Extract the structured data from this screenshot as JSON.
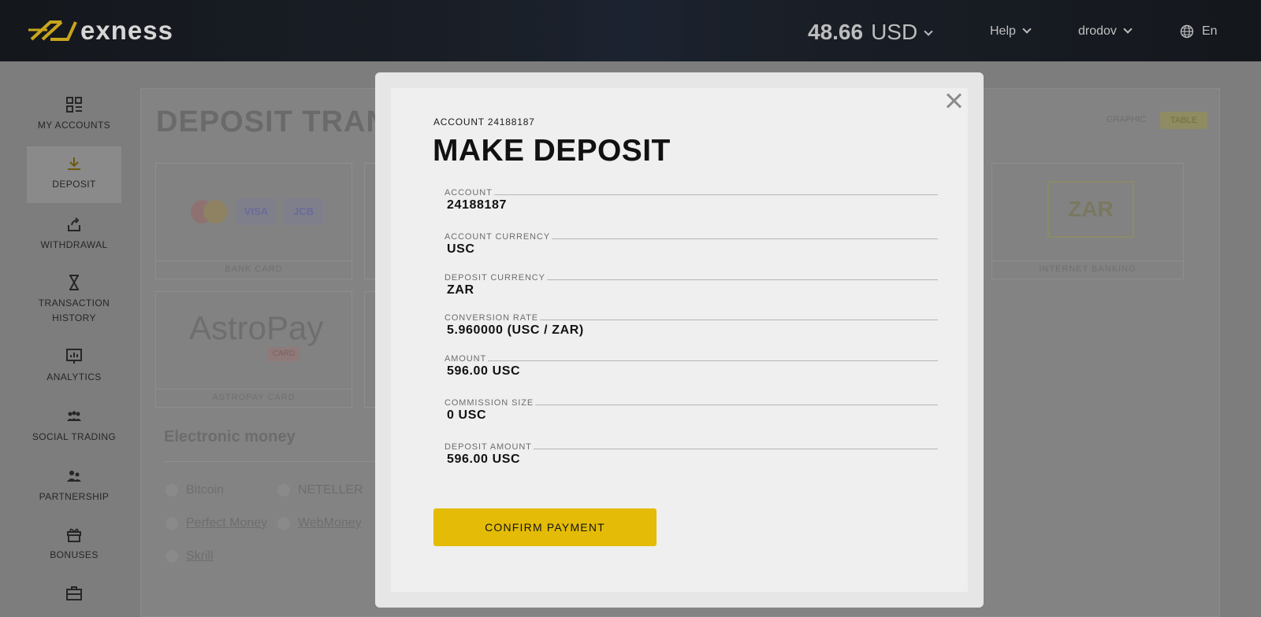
{
  "header": {
    "logo_text": "exness",
    "balance_amount": "48.66",
    "balance_currency": "USD",
    "help_label": "Help",
    "user_label": "drodov",
    "language_label": "En"
  },
  "sidebar": {
    "items": [
      {
        "label": "MY ACCOUNTS",
        "icon": "grid-icon"
      },
      {
        "label": "DEPOSIT",
        "icon": "download-icon"
      },
      {
        "label": "WITHDRAWAL",
        "icon": "upload-icon"
      },
      {
        "label": "TRANSACTION HISTORY",
        "icon": "hourglass-icon"
      },
      {
        "label": "ANALYTICS",
        "icon": "chart-board-icon"
      },
      {
        "label": "SOCIAL TRADING",
        "icon": "people-icon"
      },
      {
        "label": "PARTNERSHIP",
        "icon": "partners-icon"
      },
      {
        "label": "BONUSES",
        "icon": "gift-icon"
      }
    ]
  },
  "background_page": {
    "title_fragment": "DEPOSIT TRANS",
    "view_toggle": {
      "graphic": "GRAPHIC",
      "table": "TABLE"
    },
    "tiles": [
      {
        "caption": "BANK CARD"
      },
      {
        "caption": "ASTROPAY CARD"
      },
      {
        "caption": "INTERNET BANKING"
      }
    ],
    "card_logos": {
      "visa": "VISA",
      "jcb": "JCB"
    },
    "astropay_logo": "AstroPay",
    "astropay_sub": "CARD",
    "zar_logo": "ZAR",
    "electronic_money": {
      "heading": "Electronic money",
      "methods": [
        "Bitcoin",
        "NETELLER",
        "Perfect Money",
        "WebMoney",
        "Skrill"
      ]
    }
  },
  "modal": {
    "account_ref": "ACCOUNT 24188187",
    "title": "MAKE DEPOSIT",
    "fields": [
      {
        "label": "ACCOUNT",
        "value": "24188187"
      },
      {
        "label": "ACCOUNT CURRENCY",
        "value": "USC"
      },
      {
        "label": "DEPOSIT CURRENCY",
        "value": "ZAR"
      },
      {
        "label": "CONVERSION RATE",
        "value": "5.960000 (USC / ZAR)"
      },
      {
        "label": "AMOUNT",
        "value": "596.00 USC"
      },
      {
        "label": "COMMISSION SIZE",
        "value": "0 USC"
      },
      {
        "label": "DEPOSIT AMOUNT",
        "value": "596.00 USC"
      }
    ],
    "confirm_label": "CONFIRM PAYMENT"
  },
  "colors": {
    "accent": "#e4bc07",
    "header_bg": "#14171c",
    "overlay_bg": "#7d7d7d",
    "modal_bg": "#efefef"
  }
}
